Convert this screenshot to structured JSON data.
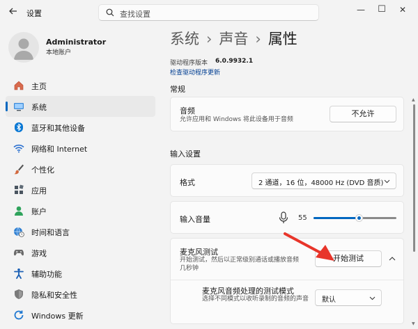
{
  "window": {
    "title": "设置",
    "search_placeholder": "查找设置",
    "minimize_icon": "—",
    "maximize_icon": "☐",
    "close_icon": "✕"
  },
  "profile": {
    "name": "Administrator",
    "account_type": "本地账户"
  },
  "sidebar": {
    "items": [
      {
        "label": "主页",
        "icon": "home-icon",
        "color": "#d1573c"
      },
      {
        "label": "系统",
        "icon": "system-icon",
        "color": "#0067c0",
        "active": true
      },
      {
        "label": "蓝牙和其他设备",
        "icon": "bluetooth-icon",
        "color": "#0078d4"
      },
      {
        "label": "网络和 Internet",
        "icon": "wifi-icon",
        "color": "#2563b8"
      },
      {
        "label": "个性化",
        "icon": "brush-icon",
        "color": "#c8663a"
      },
      {
        "label": "应用",
        "icon": "apps-icon",
        "color": "#4a5560"
      },
      {
        "label": "账户",
        "icon": "account-icon",
        "color": "#2aa05a"
      },
      {
        "label": "时间和语言",
        "icon": "globe-clock-icon",
        "color": "#1f6fbf"
      },
      {
        "label": "游戏",
        "icon": "gamepad-icon",
        "color": "#6b6b6b"
      },
      {
        "label": "辅助功能",
        "icon": "accessibility-icon",
        "color": "#1a5fb4"
      },
      {
        "label": "隐私和安全性",
        "icon": "shield-icon",
        "color": "#6b6b6b"
      },
      {
        "label": "Windows 更新",
        "icon": "update-icon",
        "color": "#1f78d1"
      }
    ]
  },
  "breadcrumb": {
    "items": [
      "系统",
      "声音"
    ],
    "current": "属性",
    "separator": "›"
  },
  "driver": {
    "version_label": "驱动程序版本",
    "version_value": "6.0.9932.1",
    "check_link": "检查驱动程序更新"
  },
  "general": {
    "section_title": "常规",
    "audio": {
      "title": "音频",
      "description": "允许应用和 Windows 将此设备用于音频",
      "button": "不允许"
    }
  },
  "input_settings": {
    "section_title": "输入设置",
    "format": {
      "title": "格式",
      "selected": "2 通道，16 位，48000 Hz (DVD 音质)"
    },
    "volume": {
      "title": "输入音量",
      "value": "55",
      "level": 0.55
    },
    "mic_test": {
      "title": "麦克风测试",
      "description_line1": "开始测试，然后以正常级别通话或播放音频",
      "description_line2": "几秒钟",
      "button": "开始测试"
    },
    "test_mode": {
      "title": "麦克风音频处理的测试模式",
      "description": "选择不同模式以收听录制的音频的声音",
      "selected": "默认"
    }
  },
  "colors": {
    "accent": "#0067c0",
    "annotation_arrow": "#e8352a"
  }
}
